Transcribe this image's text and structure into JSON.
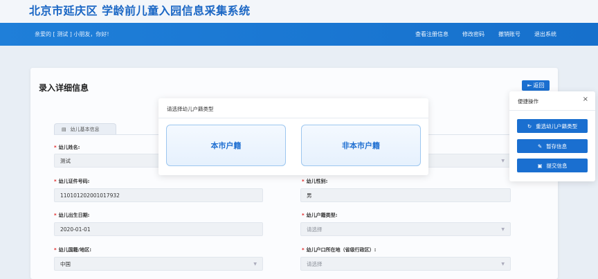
{
  "header": {
    "title": "北京市延庆区 学龄前儿童入园信息采集系统"
  },
  "navbar": {
    "greeting": "亲爱的 [ 测试 ] 小朋友，你好!",
    "links": [
      "查看注册信息",
      "修改密码",
      "撤销账号",
      "退出系统"
    ]
  },
  "main": {
    "title": "录入详细信息",
    "return_label": "返回",
    "tab_label": "幼儿基本信息",
    "fields": {
      "name": {
        "label": "幼儿姓名:",
        "value": "测试"
      },
      "id_number": {
        "label": "幼儿证件号码:",
        "value": "110101202001017932"
      },
      "gender": {
        "label": "幼儿性别:",
        "value": "男"
      },
      "birth_date": {
        "label": "幼儿出生日期:",
        "value": "2020-01-01"
      },
      "hukou_type": {
        "label": "幼儿户籍类型:",
        "placeholder": "请选择"
      },
      "nationality": {
        "label": "幼儿国籍/地区:",
        "value": "中国"
      },
      "hukou_location": {
        "label": "幼儿户口所在地（省级行政区）:",
        "placeholder": "请选择"
      }
    }
  },
  "modal": {
    "title": "请选择幼儿户籍类型",
    "options": [
      "本市户籍",
      "非本市户籍"
    ]
  },
  "quick_panel": {
    "title": "便捷操作",
    "buttons": [
      "重选幼儿户籍类型",
      "暂存信息",
      "提交信息"
    ]
  },
  "colors": {
    "primary": "#1a6fd0",
    "required": "#e02020"
  }
}
